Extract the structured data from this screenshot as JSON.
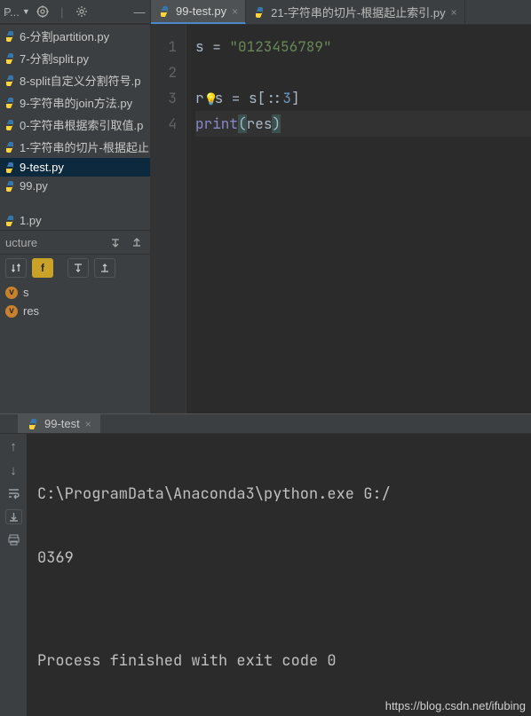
{
  "toolbar": {
    "project_label": "P..."
  },
  "editor_tabs": [
    {
      "label": "99-test.py",
      "active": true
    },
    {
      "label": "21-字符串的切片-根据起止索引.py",
      "active": false
    }
  ],
  "project_tree": {
    "items": [
      "6-分割partition.py",
      "7-分割split.py",
      "8-split自定义分割符号.p",
      "9-字符串的join方法.py",
      "0-字符串根据索引取值.p",
      "1-字符串的切片-根据起止",
      "9-test.py",
      "99.py"
    ],
    "extra": "1.py",
    "selected_index": 6
  },
  "structure": {
    "title": "ucture",
    "vars": [
      "s",
      "res"
    ]
  },
  "code": {
    "line_numbers": [
      "1",
      "2",
      "3",
      "4"
    ],
    "l1_lhs": "s = ",
    "l1_str": "\"0123456789\"",
    "l3_pre": "r",
    "l3_post": "s = s[::",
    "l3_num": "3",
    "l3_tail": "]",
    "l4_builtin": "print",
    "l4_open": "(",
    "l4_arg": "res",
    "l4_close": ")"
  },
  "run": {
    "tab_label": "99-test",
    "lines": [
      "C:\\ProgramData\\Anaconda3\\python.exe G:/",
      "0369",
      "",
      "Process finished with exit code 0"
    ],
    "watermark": "https://blog.csdn.net/ifubing"
  }
}
